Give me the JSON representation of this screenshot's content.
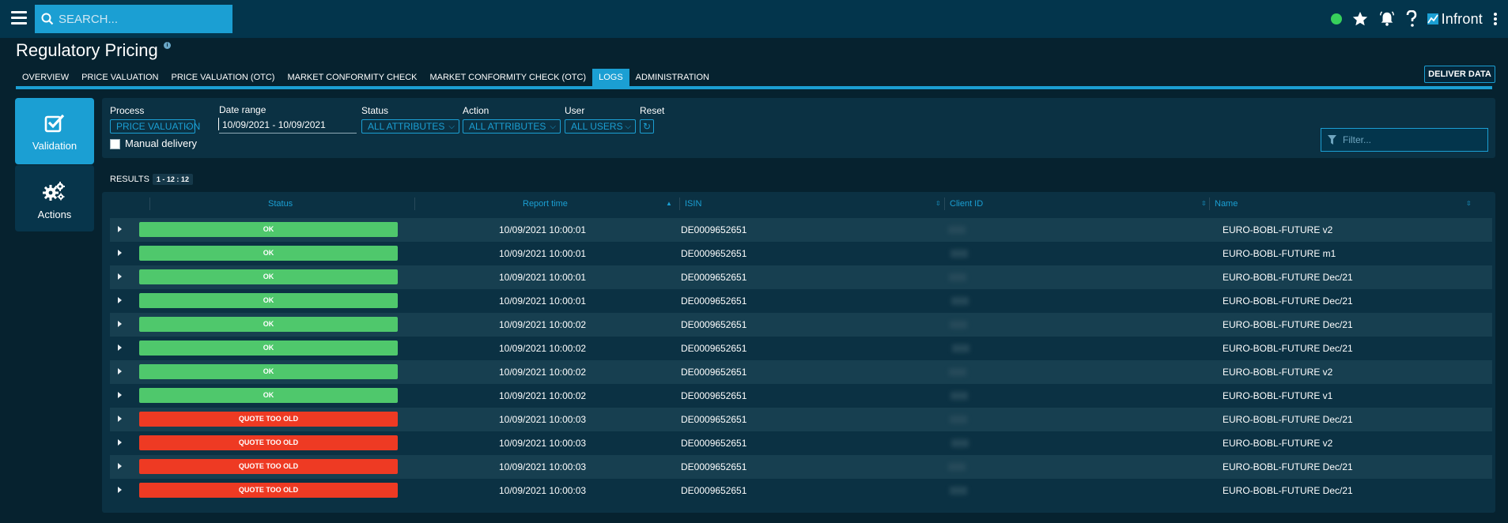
{
  "app": {
    "search_placeholder": "SEARCH...",
    "brand": "Infront",
    "status_color": "#37d05b",
    "accent_color": "#1b9fd3"
  },
  "page": {
    "title": "Regulatory Pricing",
    "info_symbol": "i",
    "tabs": [
      {
        "label": "OVERVIEW",
        "active": false
      },
      {
        "label": "PRICE VALUATION",
        "active": false
      },
      {
        "label": "PRICE VALUATION (OTC)",
        "active": false
      },
      {
        "label": "MARKET CONFORMITY CHECK",
        "active": false
      },
      {
        "label": "MARKET CONFORMITY CHECK (OTC)",
        "active": false
      },
      {
        "label": "LOGS",
        "active": true
      },
      {
        "label": "ADMINISTRATION",
        "active": false
      }
    ],
    "deliver_label": "DELIVER DATA"
  },
  "sidebar": {
    "validation_label": "Validation",
    "actions_label": "Actions"
  },
  "filters": {
    "process_label": "Process",
    "process_value": "PRICE VALUATION",
    "date_label": "Date range",
    "date_value": "10/09/2021 - 10/09/2021",
    "status_label": "Status",
    "status_value": "ALL ATTRIBUTES",
    "action_label": "Action",
    "action_value": "ALL ATTRIBUTES",
    "user_label": "User",
    "user_value": "ALL USERS",
    "reset_label": "Reset",
    "manual_label": "Manual delivery",
    "filter_placeholder": "Filter..."
  },
  "results": {
    "label": "RESULTS",
    "count": "1 - 12 : 12"
  },
  "table": {
    "columns": {
      "status": "Status",
      "report_time": "Report time",
      "isin": "ISIN",
      "client_id": "Client ID",
      "name": "Name"
    },
    "rows": [
      {
        "status": "OK",
        "type": "ok",
        "time": "10/09/2021 10:00:01",
        "isin": "DE0009652651",
        "name": "EURO-BOBL-FUTURE v2"
      },
      {
        "status": "OK",
        "type": "ok",
        "time": "10/09/2021 10:00:01",
        "isin": "DE0009652651",
        "name": "EURO-BOBL-FUTURE m1"
      },
      {
        "status": "OK",
        "type": "ok",
        "time": "10/09/2021 10:00:01",
        "isin": "DE0009652651",
        "name": "EURO-BOBL-FUTURE Dec/21"
      },
      {
        "status": "OK",
        "type": "ok",
        "time": "10/09/2021 10:00:01",
        "isin": "DE0009652651",
        "name": "EURO-BOBL-FUTURE Dec/21"
      },
      {
        "status": "OK",
        "type": "ok",
        "time": "10/09/2021 10:00:02",
        "isin": "DE0009652651",
        "name": "EURO-BOBL-FUTURE Dec/21"
      },
      {
        "status": "OK",
        "type": "ok",
        "time": "10/09/2021 10:00:02",
        "isin": "DE0009652651",
        "name": "EURO-BOBL-FUTURE Dec/21"
      },
      {
        "status": "OK",
        "type": "ok",
        "time": "10/09/2021 10:00:02",
        "isin": "DE0009652651",
        "name": "EURO-BOBL-FUTURE v2"
      },
      {
        "status": "OK",
        "type": "ok",
        "time": "10/09/2021 10:00:02",
        "isin": "DE0009652651",
        "name": "EURO-BOBL-FUTURE v1"
      },
      {
        "status": "QUOTE TOO OLD",
        "type": "old",
        "time": "10/09/2021 10:00:03",
        "isin": "DE0009652651",
        "name": "EURO-BOBL-FUTURE Dec/21"
      },
      {
        "status": "QUOTE TOO OLD",
        "type": "old",
        "time": "10/09/2021 10:00:03",
        "isin": "DE0009652651",
        "name": "EURO-BOBL-FUTURE v2"
      },
      {
        "status": "QUOTE TOO OLD",
        "type": "old",
        "time": "10/09/2021 10:00:03",
        "isin": "DE0009652651",
        "name": "EURO-BOBL-FUTURE Dec/21"
      },
      {
        "status": "QUOTE TOO OLD",
        "type": "old",
        "time": "10/09/2021 10:00:03",
        "isin": "DE0009652651",
        "name": "EURO-BOBL-FUTURE Dec/21"
      }
    ]
  }
}
